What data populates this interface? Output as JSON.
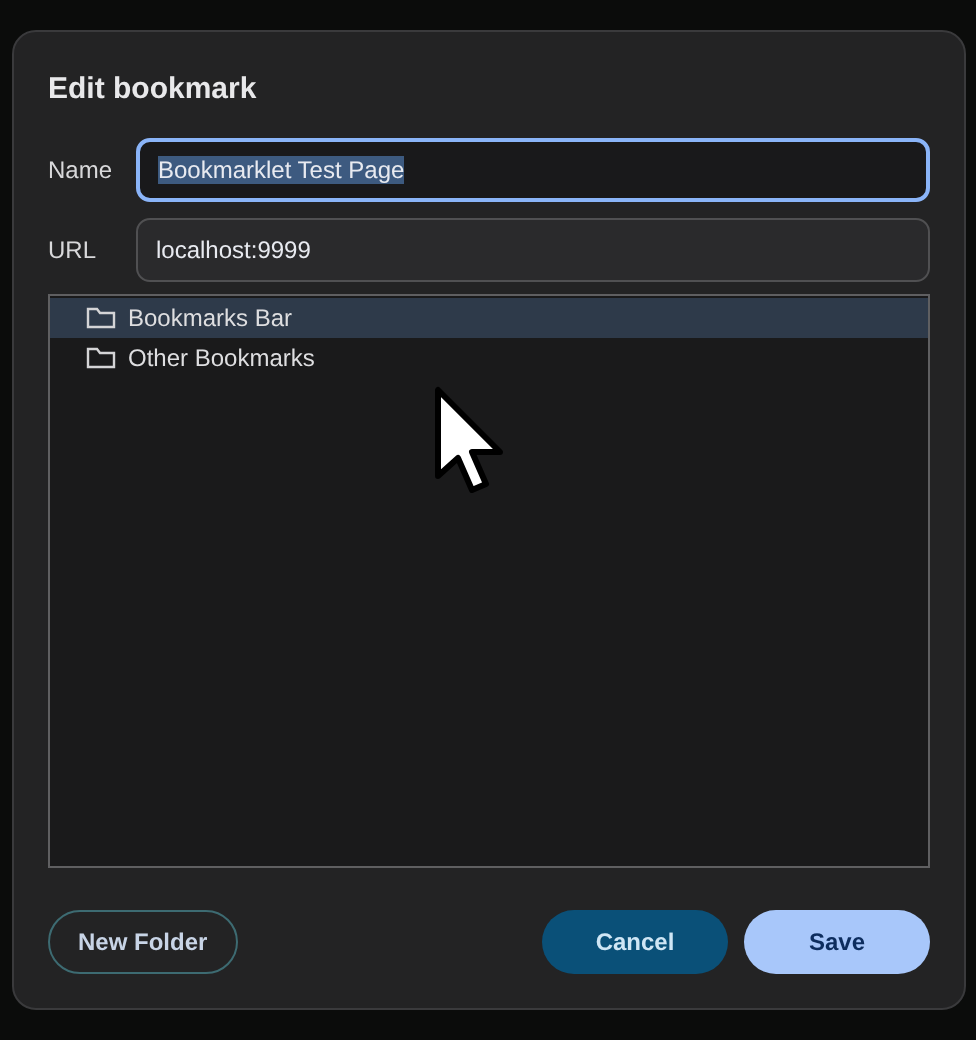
{
  "dialog": {
    "title": "Edit bookmark",
    "fields": [
      {
        "label": "Name",
        "value": "Bookmarklet Test Page",
        "focused": true
      },
      {
        "label": "URL",
        "value": "localhost:9999",
        "focused": false
      }
    ],
    "folders": [
      {
        "label": "Bookmarks Bar",
        "selected": true
      },
      {
        "label": "Other Bookmarks",
        "selected": false
      }
    ],
    "buttons": [
      {
        "label": "New Folder",
        "kind": "outline"
      },
      {
        "label": "Cancel",
        "kind": "secondary"
      },
      {
        "label": "Save",
        "kind": "primary"
      }
    ]
  }
}
